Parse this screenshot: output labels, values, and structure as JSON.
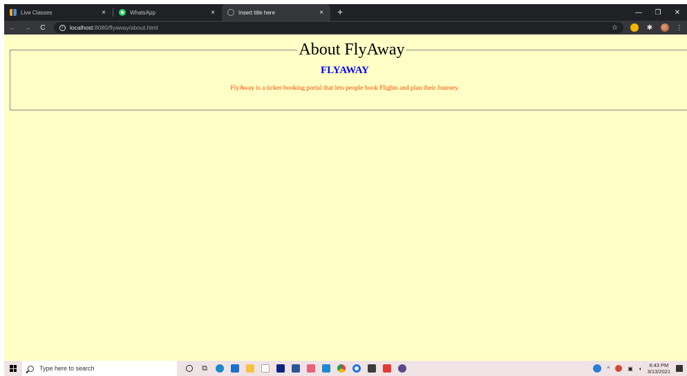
{
  "browser": {
    "tabs": [
      {
        "title": "Live Classes",
        "favicon": "live-classes-icon",
        "active": false
      },
      {
        "title": "WhatsApp",
        "favicon": "whatsapp-icon",
        "active": false
      },
      {
        "title": "Insert title here",
        "favicon": "globe-icon",
        "active": true
      }
    ],
    "new_tab_glyph": "+",
    "close_glyph": "×",
    "window_controls": {
      "minimize": "—",
      "maximize": "❐",
      "close": "✕"
    },
    "address": {
      "host": "localhost",
      "path": ":8080/flyaway/about.html"
    },
    "nav": {
      "back": "←",
      "forward": "→",
      "reload": "C"
    }
  },
  "page": {
    "background": "#ffffc6",
    "legend": "About FlyAway",
    "brand": "FLYAWAY",
    "brand_color": "#0000ff",
    "description": "FlyAway is a ticket-booking portal that lets people book Flights and plan their Journey.",
    "description_color": "#ff4500"
  },
  "taskbar": {
    "search_placeholder": "Type here to search",
    "clock": {
      "time": "6:43 PM",
      "date": "3/13/2021"
    }
  }
}
